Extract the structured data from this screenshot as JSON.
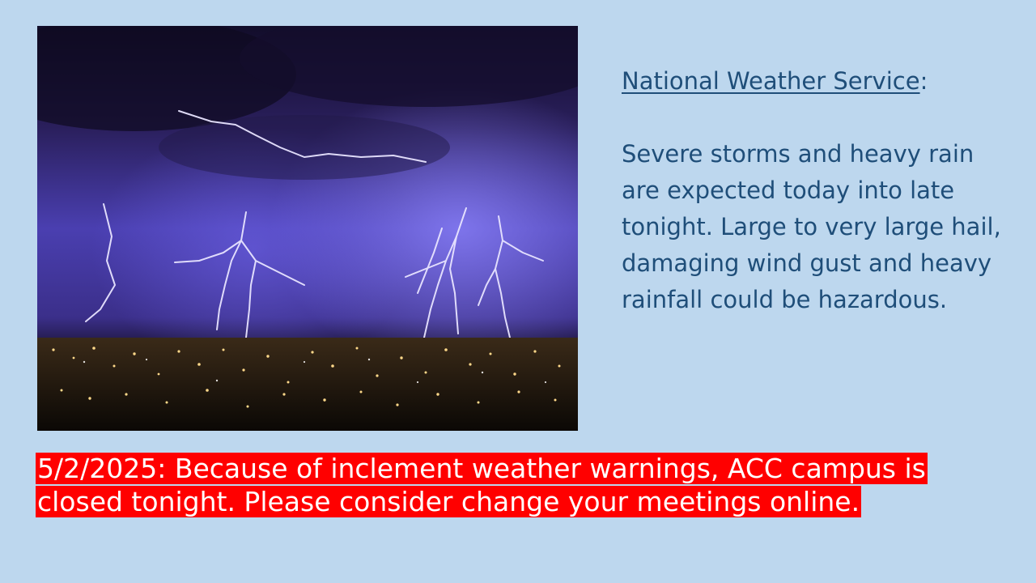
{
  "nws": {
    "heading": "National Weather Service",
    "heading_suffix": ":",
    "body": "Severe storms and heavy rain are expected today into late tonight. Large to very large hail, damaging wind gust and heavy rainfall could be hazardous."
  },
  "alert": {
    "text": "5/2/2025: Because of inclement weather warnings, ACC campus is closed tonight. Please consider change your meetings online."
  },
  "colors": {
    "slide_background": "#bdd7ee",
    "text_blue": "#1f4e79",
    "alert_red": "#ff0000",
    "alert_text": "#ffffff"
  },
  "image": {
    "icon": "lightning-storm-photo"
  }
}
